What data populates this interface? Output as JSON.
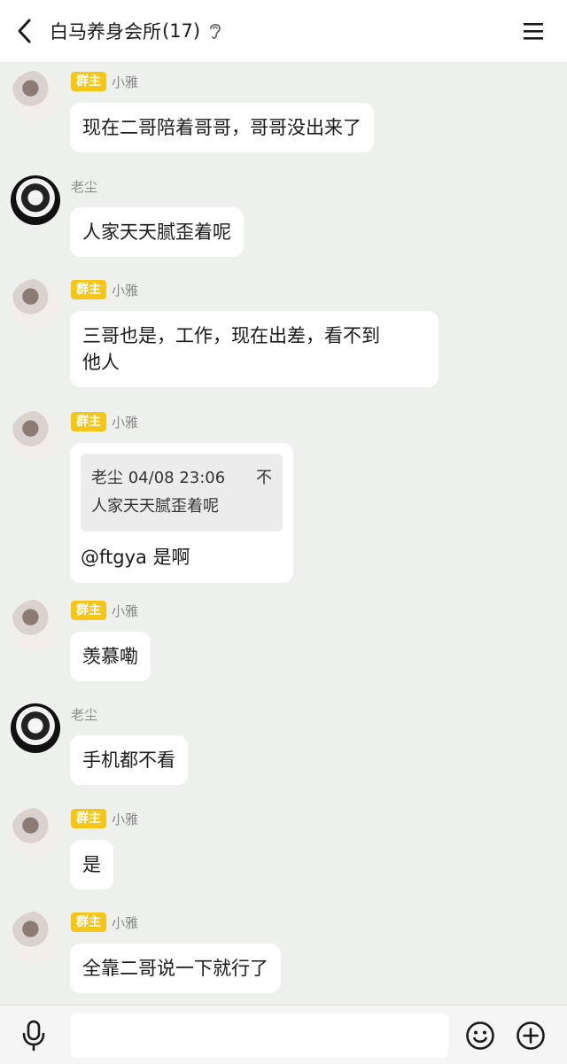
{
  "header": {
    "title": "白马养身会所",
    "member_count": "(17)"
  },
  "roles": {
    "owner_badge": "群主"
  },
  "messages": [
    {
      "sender": "小雅",
      "badge": "群主",
      "text": "现在二哥陪着哥哥，哥哥没出来了"
    },
    {
      "sender": "老尘",
      "text": "人家天天腻歪着呢"
    },
    {
      "sender": "小雅",
      "badge": "群主",
      "text_line1": "三哥也是，工作，现在出差，看不到",
      "text_line2": "他人"
    },
    {
      "sender": "小雅",
      "badge": "群主",
      "quote_author": "老尘 04/08 23:06",
      "quote_flag": "不",
      "quote_text": "人家天天腻歪着呢",
      "text": "@ftgya 是啊"
    },
    {
      "sender": "小雅",
      "badge": "群主",
      "text": "羡慕嘞"
    },
    {
      "sender": "老尘",
      "text": "手机都不看"
    },
    {
      "sender": "小雅",
      "badge": "群主",
      "text": "是"
    },
    {
      "sender": "小雅",
      "badge": "群主",
      "text": "全靠二哥说一下就行了"
    }
  ],
  "input": {
    "value": "",
    "placeholder": ""
  },
  "icons": {
    "back": "back-chevron-icon",
    "ear": "ear-icon",
    "menu": "menu-icon",
    "mic": "microphone-icon",
    "emoji": "emoji-icon",
    "plus": "plus-icon"
  },
  "colors": {
    "badge": "#f5c518",
    "chat_background": "#eef0ee",
    "bubble": "#ffffff"
  }
}
